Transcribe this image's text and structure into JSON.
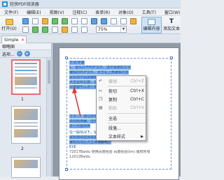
{
  "app": {
    "title": "轻快PDF阅读器"
  },
  "menu": [
    "文件(F)",
    "编辑(E)",
    "视图(V)",
    "注释(C)",
    "表单(R)",
    "对象(O)",
    "工具(T)",
    "窗口(W)"
  ],
  "toolbar": {
    "open_label": "打开(O)",
    "zoom_value": "75%",
    "edit_content_label": "编辑内容",
    "add_text_label": "添加文本"
  },
  "tabs": [
    {
      "label": "Simple"
    }
  ],
  "thumbnails": {
    "header": "缩略图",
    "options_label": "选项...",
    "pages": [
      "1",
      "2"
    ]
  },
  "document": {
    "lines": [
      "方法/步骤",
      "1、首先打开PDF文件，选中需要的文字",
      "编辑的PDF文件，点击右上角编辑内容",
      "鼠标选中需要编辑的内容",
      "点击鼠标右键，选择需要的操作",
      "阅读器可以进行复制，粘贴",
      "",
      "方法二：通过转换为Word格式",
      "启动转换器，选择PDF转Word，",
      "进行完整转换",
      "在一般情况下，鼠标选中内容",
      "鼠标拖动选择需要编辑的文字段落，",
      "编辑完成后点击保存即可，",
      "EXE",
      "72017Baidu 使用百度经验 百度经验(tm) 版权所有",
      "12012Baidu"
    ]
  },
  "context_menu": {
    "items": [
      {
        "label": "撤销",
        "shortcut": "Ctrl+Z",
        "enabled": false,
        "icon": "undo-icon"
      },
      {
        "label": "剪切",
        "shortcut": "Ctrl+X",
        "enabled": true,
        "icon": "cut-icon"
      },
      {
        "label": "复制",
        "shortcut": "Ctrl+C",
        "enabled": true,
        "icon": "copy-icon"
      },
      {
        "label": "粘贴",
        "shortcut": "Ctrl+V",
        "enabled": false,
        "icon": "paste-icon"
      },
      {
        "label": "全选",
        "shortcut": "",
        "enabled": true,
        "icon": ""
      },
      {
        "label": "段落...",
        "shortcut": "",
        "enabled": true,
        "icon": ""
      },
      {
        "label": "文本样式",
        "shortcut": "",
        "enabled": true,
        "icon": "",
        "submenu": true
      }
    ]
  },
  "colors": {
    "accent": "#1b8fd6",
    "selection": "#7fb3ee",
    "menu_bg": "#f8f8f8"
  }
}
